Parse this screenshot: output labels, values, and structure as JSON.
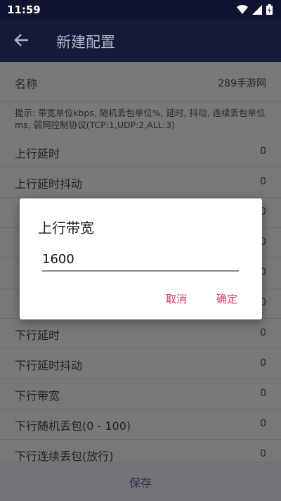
{
  "status": {
    "time": "11:59"
  },
  "appbar": {
    "title": "新建配置"
  },
  "name_row": {
    "label": "名称",
    "value": "289手游网"
  },
  "hint": "提示: 带宽单位kbps, 随机丢包单位%, 延时, 抖动, 连续丢包单位ms, 弱网控制协议(TCP:1,UDP:2,ALL:3)",
  "rows": [
    {
      "label": "上行延时",
      "value": "0"
    },
    {
      "label": "上行延时抖动",
      "value": "0"
    },
    {
      "label": "",
      "value": "0"
    },
    {
      "label": "",
      "value": "0"
    },
    {
      "label": "",
      "value": "0"
    },
    {
      "label": "",
      "value": "0"
    },
    {
      "label": "下行延时",
      "value": "0"
    },
    {
      "label": "下行延时抖动",
      "value": "0"
    },
    {
      "label": "下行带宽",
      "value": "0"
    },
    {
      "label": "下行随机丢包(0 - 100)",
      "value": "0"
    },
    {
      "label": "下行连续丢包(放行)",
      "value": "0"
    }
  ],
  "bottom": {
    "save_label": "保存"
  },
  "dialog": {
    "title": "上行带宽",
    "input_value": "1600",
    "cancel_label": "取消",
    "ok_label": "确定"
  },
  "colors": {
    "accent": "#e3336b",
    "appbar": "#141a38"
  },
  "icons": {
    "back": "arrow-left-icon",
    "wifi": "wifi-icon",
    "signal": "signal-icon",
    "battery": "battery-icon"
  }
}
